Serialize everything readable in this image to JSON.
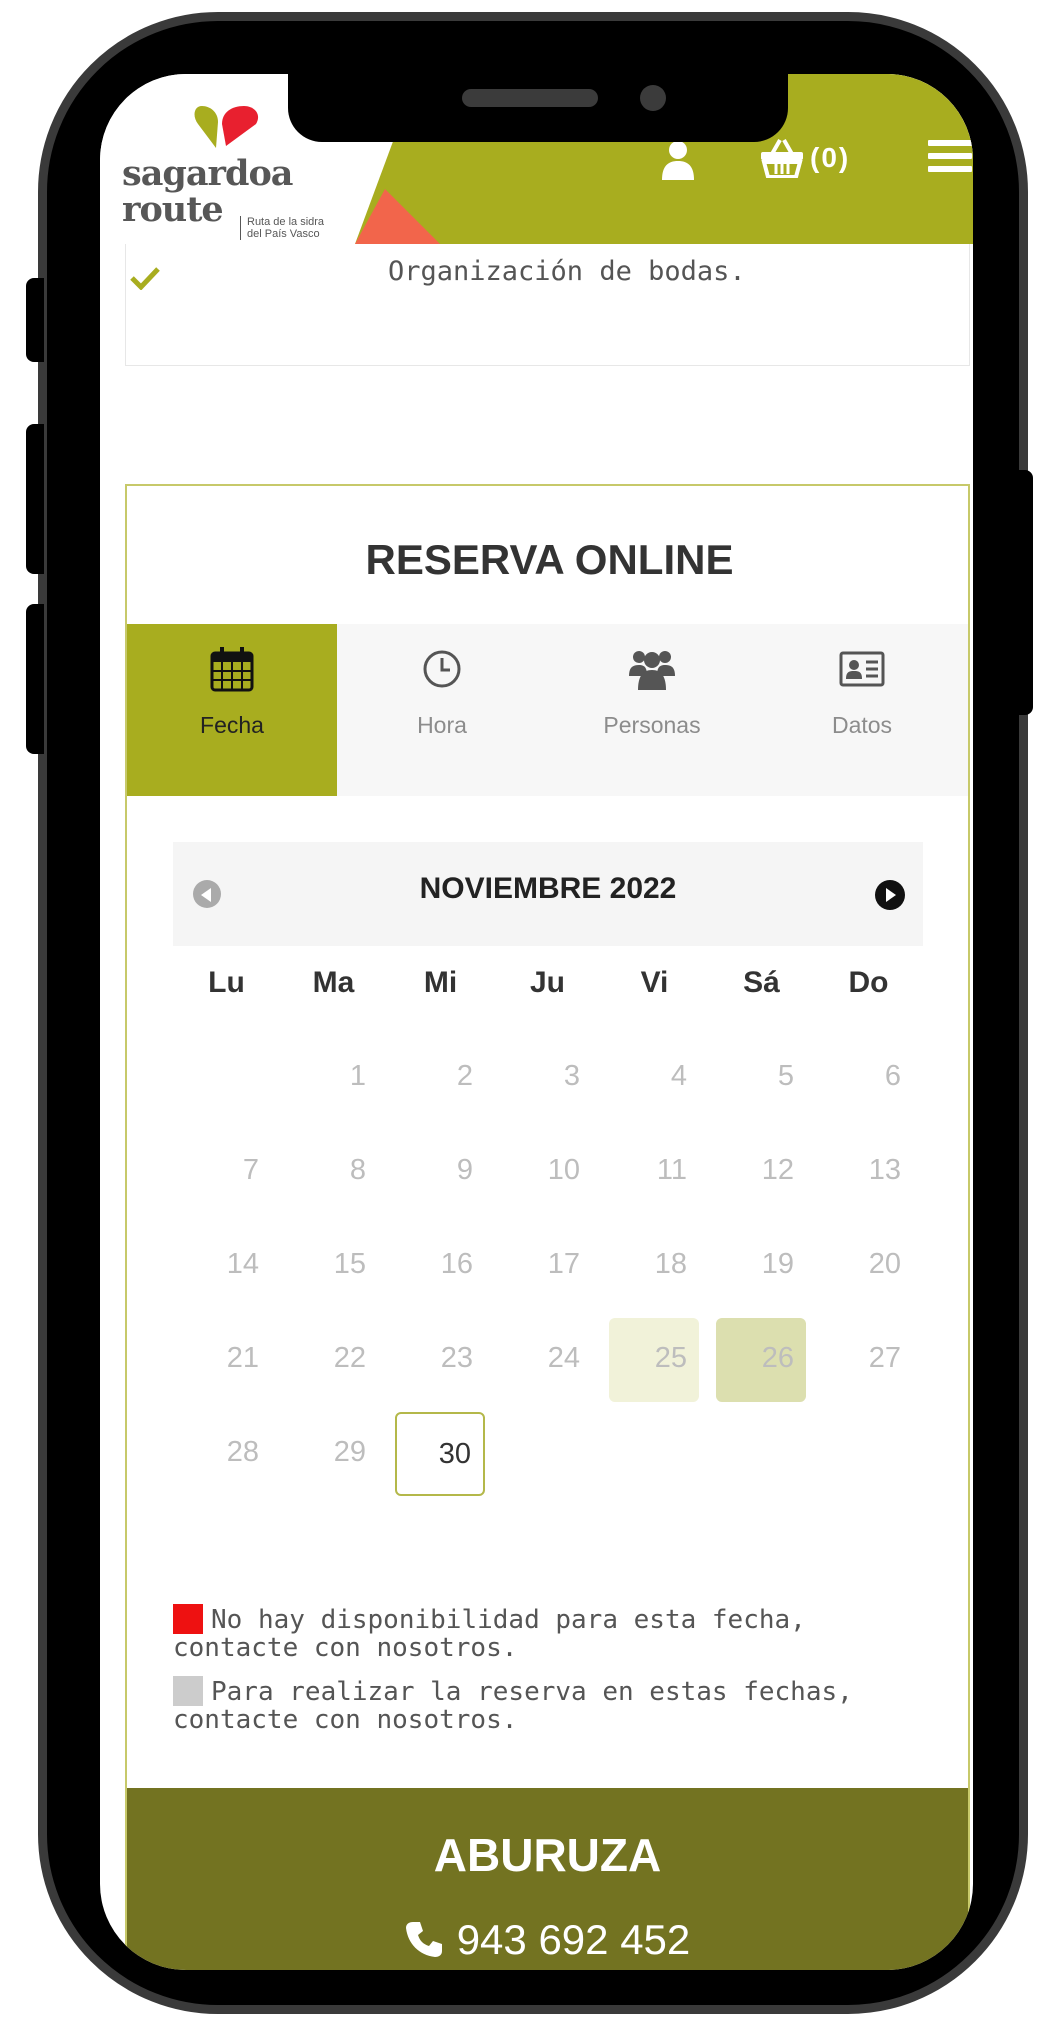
{
  "header": {
    "logo_line1": "sagardoa",
    "logo_line2": "route",
    "logo_sub1": "Ruta de la sidra",
    "logo_sub2": "del País Vasco",
    "basket_count": "(0)",
    "accent_color": "#a8ad1f"
  },
  "feature": {
    "text": "Organización de bodas."
  },
  "reservation": {
    "title": "RESERVA ONLINE",
    "tabs": [
      {
        "label": "Fecha",
        "icon": "calendar-icon",
        "active": true
      },
      {
        "label": "Hora",
        "icon": "clock-icon",
        "active": false
      },
      {
        "label": "Personas",
        "icon": "users-icon",
        "active": false
      },
      {
        "label": "Datos",
        "icon": "id-card-icon",
        "active": false
      }
    ],
    "calendar": {
      "month": "NOVIEMBRE 2022",
      "weekdays": [
        "Lu",
        "Ma",
        "Mi",
        "Ju",
        "Vi",
        "Sá",
        "Do"
      ],
      "days": [
        [
          "",
          "1",
          "2",
          "3",
          "4",
          "5",
          "6"
        ],
        [
          "7",
          "8",
          "9",
          "10",
          "11",
          "12",
          "13"
        ],
        [
          "14",
          "15",
          "16",
          "17",
          "18",
          "19",
          "20"
        ],
        [
          "21",
          "22",
          "23",
          "24",
          "25",
          "26",
          "27"
        ],
        [
          "28",
          "29",
          "30",
          "",
          "",
          "",
          ""
        ]
      ],
      "highlighted_days": [
        "25",
        "26"
      ],
      "selected_day": "30"
    },
    "legend": [
      {
        "color": "#ee1111",
        "text": "No hay disponibilidad para esta fecha, contacte con nosotros."
      },
      {
        "color": "#cccccc",
        "text": "Para realizar la reserva en estas fechas, contacte con nosotros."
      }
    ]
  },
  "footer": {
    "name": "ABURUZA",
    "phone": "943 692 452",
    "background": "#737321"
  }
}
